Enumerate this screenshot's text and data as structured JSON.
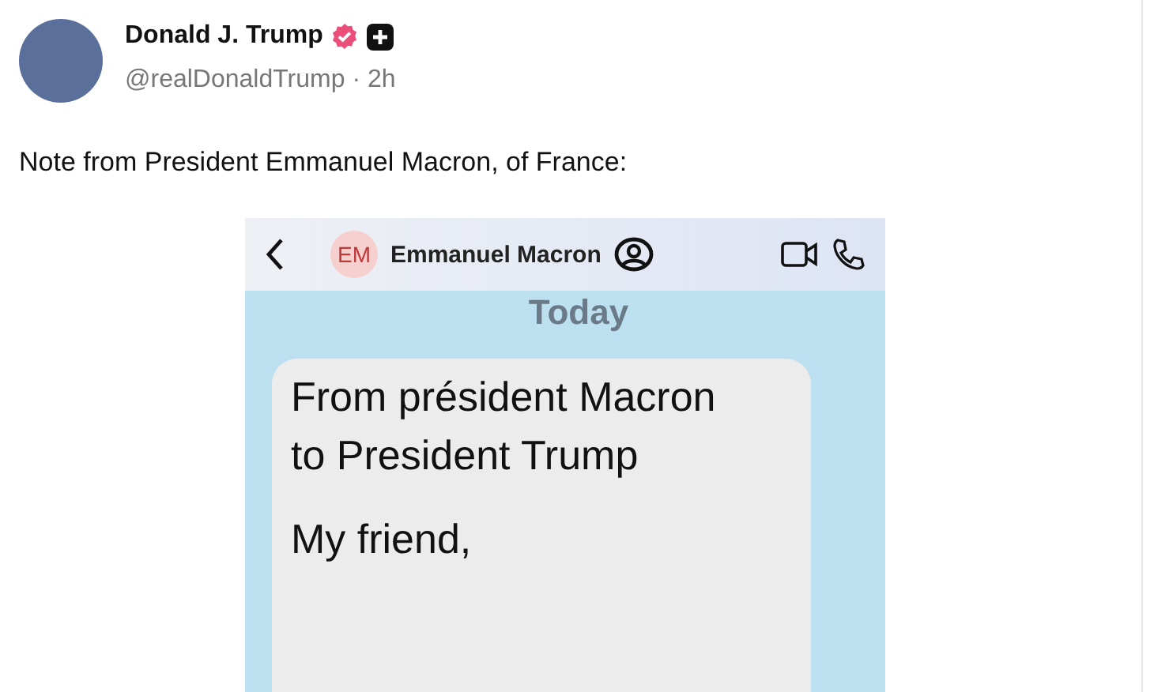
{
  "post": {
    "author": {
      "name": "Donald J. Trump",
      "handle": "@realDonaldTrump",
      "time": "· 2h",
      "verified": true
    },
    "text": "Note from President Emmanuel Macron, of France:",
    "image": {
      "contact": {
        "initials": "EM",
        "name": "Emmanuel Macron"
      },
      "date": "Today",
      "messages": [
        {
          "paragraphs": [
            "From président Macron\nto President Trump",
            "My friend,"
          ]
        }
      ]
    }
  }
}
